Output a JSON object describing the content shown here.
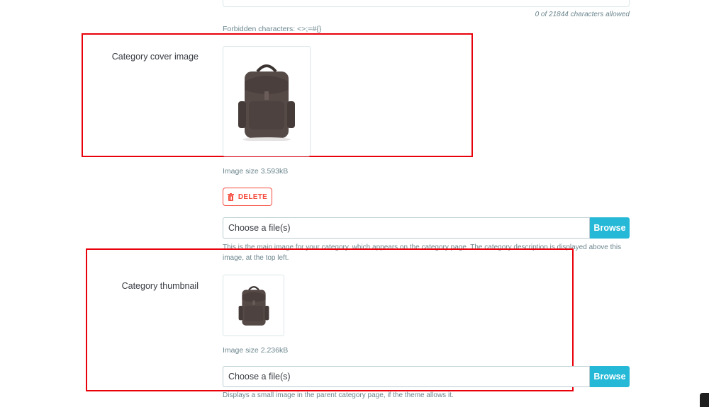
{
  "description_field": {
    "char_count": "0 of 21844 characters allowed",
    "forbidden": "Forbidden characters: <>;=#{}"
  },
  "cover_image": {
    "label": "Category cover image",
    "image_size": "Image size 3.593kB",
    "delete_label": "DELETE",
    "file_placeholder": "Choose a file(s)",
    "browse_label": "Browse",
    "help": "This is the main image for your category, which appears on the category page. The category description is displayed above this image, at the top left."
  },
  "thumbnail": {
    "label": "Category thumbnail",
    "image_size": "Image size 2.236kB",
    "file_placeholder": "Choose a file(s)",
    "browse_label": "Browse",
    "help": "Displays a small image in the parent category page, if the theme allows it."
  },
  "colors": {
    "accent": "#25b9d7",
    "danger": "#f54c3e",
    "highlight_border": "#e8000b"
  },
  "icons": {
    "delete": "trash-icon",
    "product": "backpack-image"
  }
}
